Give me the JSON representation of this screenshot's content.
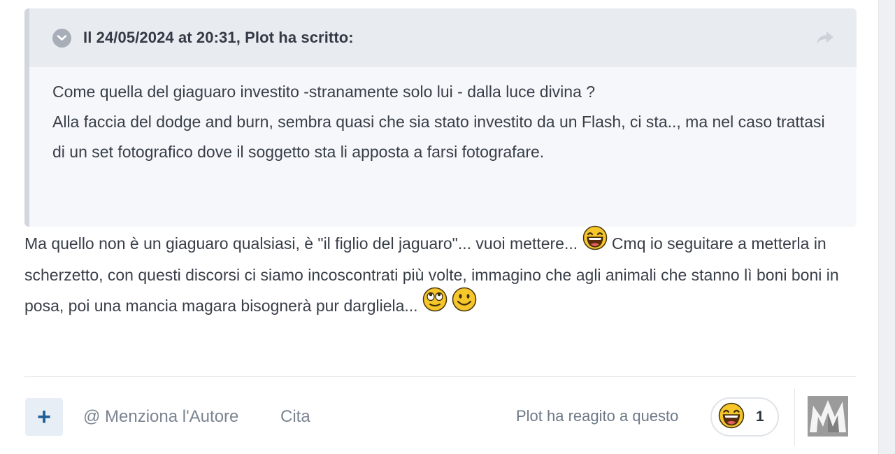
{
  "quote": {
    "header": "Il 24/05/2024 at 20:31, Plot ha scritto:",
    "lines": [
      "Come quella del giaguaro investito -stranamente solo lui - dalla luce divina ?",
      "Alla faccia del dodge and burn, sembra quasi che sia stato investito da un Flash, ci sta.., ma nel caso trattasi di un set fotografico dove il soggetto sta li apposta a farsi fotografare."
    ]
  },
  "post": {
    "part1": "Ma quello non è un giaguaro qualsiasi, è \"il figlio del jaguaro\"... vuoi mettere... ",
    "part2": " Cmq  io seguitare a metterla in scherzetto, con questi discorsi ci siamo incoscontrati più volte, immagino che agli animali che stanno lì boni boni in posa, poi una mancia magara bisognerà pur dargliela... ",
    "emojis": [
      "laughing-face",
      "rolling-eyes-face",
      "smiling-face"
    ]
  },
  "footer": {
    "plus_label": "+",
    "mention_label": "@ Menziona l'Autore",
    "quote_label": "Cita",
    "reaction_text": "Plot ha reagito a questo",
    "reaction_count": "1",
    "reaction_emoji": "laughing-face"
  },
  "colors": {
    "quote_bg": "#f5f7fa",
    "quote_header_bg": "#e8ebef",
    "accent_blue": "#1f5d96",
    "muted_text": "#7a8491"
  }
}
